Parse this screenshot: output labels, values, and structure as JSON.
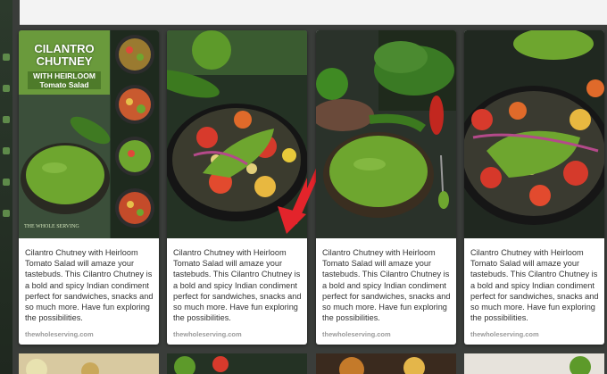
{
  "cards": [
    {
      "title_main": "CILANTRO CHUTNEY",
      "title_sub": "WITH HEIRLOOM Tomato Salad",
      "watermark": "THE WHOLE SERVING",
      "description": "Cilantro Chutney with Heirloom Tomato Salad will amaze your tastebuds. This Cilantro Chutney is a bold and spicy Indian condiment perfect for sandwiches, snacks and so much more. Have fun exploring the possibilities.",
      "source": "thewholeserving.com"
    },
    {
      "description": "Cilantro Chutney with Heirloom Tomato Salad will amaze your tastebuds. This Cilantro Chutney is a bold and spicy Indian condiment perfect for sandwiches, snacks and so much more. Have fun exploring the possibilities.",
      "source": "thewholeserving.com"
    },
    {
      "description": "Cilantro Chutney with Heirloom Tomato Salad will amaze your tastebuds. This Cilantro Chutney is a bold and spicy Indian condiment perfect for sandwiches, snacks and so much more. Have fun exploring the possibilities.",
      "source": "thewholeserving.com"
    },
    {
      "description": "Cilantro Chutney with Heirloom Tomato Salad will amaze your tastebuds. This Cilantro Chutney is a bold and spicy Indian condiment perfect for sandwiches, snacks and so much more. Have fun exploring the possibilities.",
      "source": "thewholeserving.com"
    }
  ],
  "colors": {
    "page_bg": "#3a3d3a",
    "card_bg": "#ffffff",
    "chutney_green": "#6ea62f",
    "annotation_arrow": "#e3242b"
  }
}
